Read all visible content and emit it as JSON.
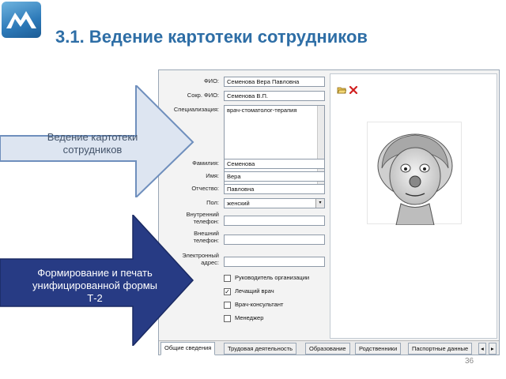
{
  "slide": {
    "title": "3.1. Ведение картотеки сотрудников",
    "page_number": "36"
  },
  "arrows": {
    "upper": {
      "text": "Ведение картотеки сотрудников"
    },
    "lower": {
      "text_line1": "Формирование и печать",
      "text_line2": "унифицированной формы",
      "text_line3": "Т-2"
    }
  },
  "form": {
    "fio": {
      "label": "ФИО:",
      "value": "Семенова Вера Павловна"
    },
    "short_fio": {
      "label": "Сокр. ФИО:",
      "value": "Семенова В.П."
    },
    "specialization": {
      "label": "Специализация:",
      "value": "врач-стоматолог-терапия"
    },
    "surname": {
      "label": "Фамилия:",
      "value": "Семенова"
    },
    "name": {
      "label": "Имя:",
      "value": "Вера"
    },
    "patronymic": {
      "label": "Отчество:",
      "value": "Павловна"
    },
    "gender": {
      "label": "Пол:",
      "value": "женский"
    },
    "inner_phone": {
      "label_line1": "Внутренний",
      "label_line2": "телефон:",
      "value": ""
    },
    "outer_phone": {
      "label_line1": "Внешний",
      "label_line2": "телефон:",
      "value": ""
    },
    "email": {
      "label_line1": "Электронный",
      "label_line2": "адрес:",
      "value": ""
    },
    "checkboxes": [
      {
        "label": "Руководитель организации",
        "checked": false
      },
      {
        "label": "Лечащий врач",
        "checked": true
      },
      {
        "label": "Врач-консультант",
        "checked": false
      },
      {
        "label": "Менеджер",
        "checked": false
      }
    ],
    "checked_mark": "✓",
    "tabs": [
      "Общие сведения",
      "Трудовая деятельность",
      "Образование",
      "Родственники",
      "Паспортные данные"
    ],
    "tab_scroll": {
      "left": "◂",
      "right": "▸"
    },
    "dropdown_glyph": "▾"
  },
  "colors": {
    "arrow_upper_fill": "#dde5f1",
    "arrow_upper_stroke": "#6f8fbd",
    "arrow_lower_fill": "#273b84",
    "title": "#2e6ea6"
  },
  "icons": {
    "open": "open-folder-icon",
    "delete": "delete-x-icon"
  }
}
